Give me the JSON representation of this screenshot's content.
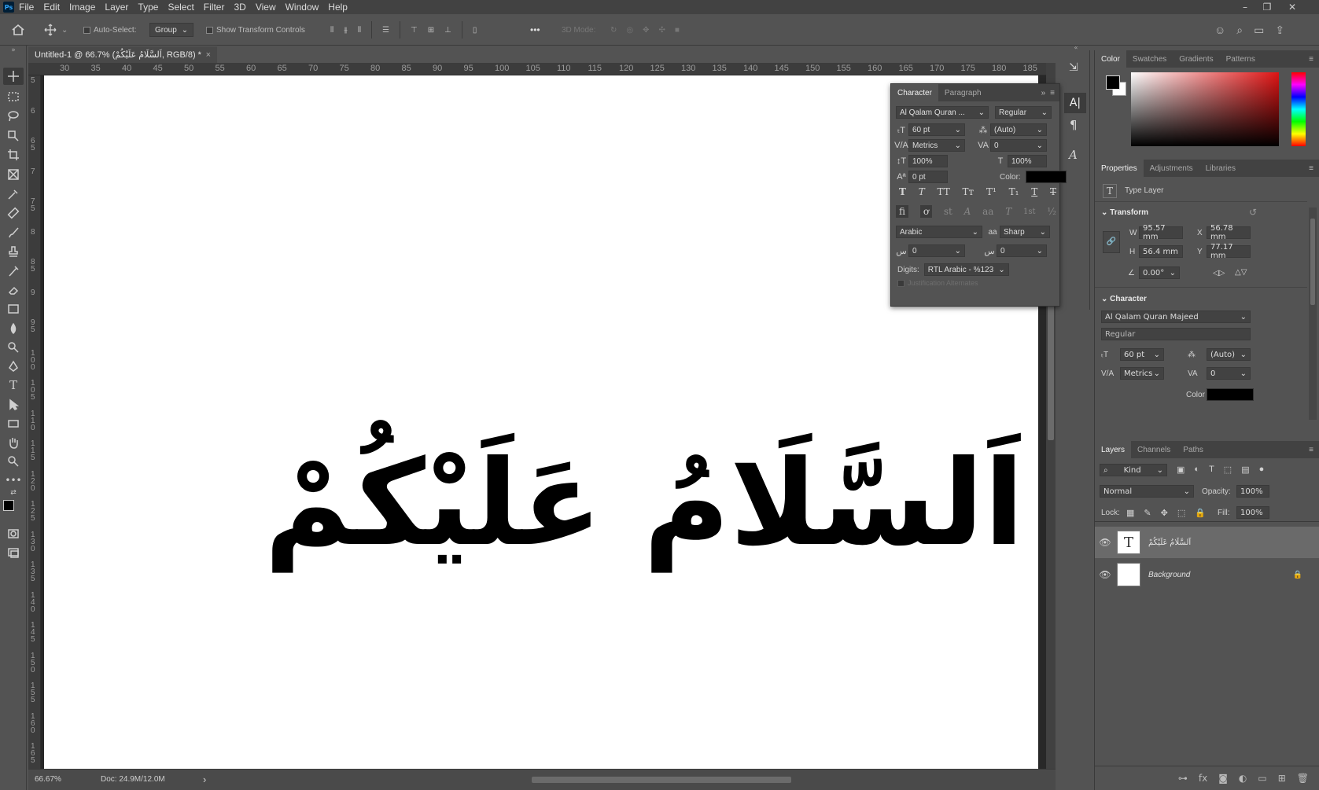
{
  "app": {
    "logo": "Ps",
    "document_tab": "Untitled-1 @ 66.7% (اَلسَّلَامُ عَلَيْكُمْ, RGB/8) *",
    "tab_close": "×"
  },
  "menu": [
    "File",
    "Edit",
    "Image",
    "Layer",
    "Type",
    "Select",
    "Filter",
    "3D",
    "View",
    "Window",
    "Help"
  ],
  "window_controls": {
    "minimize": "–",
    "restore": "❐",
    "close": "✕"
  },
  "options": {
    "auto_select_label": "Auto-Select:",
    "group_value": "Group",
    "transform_controls_label": "Show Transform Controls",
    "more": "•••",
    "mode_label": "3D Mode:"
  },
  "ruler_top": [
    "30",
    "35",
    "40",
    "45",
    "50",
    "55",
    "60",
    "65",
    "70",
    "75",
    "80",
    "85",
    "90",
    "95",
    "100",
    "105",
    "110",
    "115",
    "120",
    "125",
    "130",
    "135",
    "140",
    "145",
    "150",
    "155",
    "160",
    "165",
    "170",
    "175",
    "180",
    "185"
  ],
  "ruler_left": [
    "5",
    "6",
    "6 5",
    "7",
    "7 5",
    "8",
    "8 5",
    "9",
    "9 5",
    "1 0 0",
    "1 0 5",
    "1 1 0",
    "1 1 5",
    "1 2 0",
    "1 2 5",
    "1 3 0",
    "1 3 5",
    "1 4 0",
    "1 4 5",
    "1 5 0",
    "1 5 5",
    "1 6 0",
    "1 6 5"
  ],
  "canvas_text": "اَلسَّلَامُ عَلَيْكُمْ",
  "status": {
    "zoom": "66.67%",
    "doc": "Doc: 24.9M/12.0M",
    "arrow": "›"
  },
  "character_panel": {
    "tab_character": "Character",
    "tab_paragraph": "Paragraph",
    "font_family": "Al Qalam Quran ...",
    "font_style": "Regular",
    "size": "60 pt",
    "leading": "(Auto)",
    "kerning": "Metrics",
    "tracking": "0",
    "vscale": "100%",
    "hscale": "100%",
    "baseline": "0 pt",
    "color_label": "Color:",
    "color": "#000000",
    "language": "Arabic",
    "antialias_icon": "aa",
    "antialias": "Sharp",
    "ligature1": "0",
    "ligature2": "0",
    "digits_label": "Digits:",
    "digits_value": "RTL Arabic - %123",
    "justification": "Justification Alternates",
    "style_buttons": [
      "T",
      "T",
      "TT",
      "Tт",
      "T¹",
      "T₁",
      "T",
      "T"
    ],
    "opentype_buttons": [
      "fi",
      "ơ",
      "st",
      "A",
      "aa",
      "T",
      "1st",
      "½"
    ]
  },
  "color_panel": {
    "tabs": [
      "Color",
      "Swatches",
      "Gradients",
      "Patterns"
    ],
    "foreground": "#000000",
    "background": "#ffffff",
    "hue_color": "#e01414"
  },
  "properties_panel": {
    "tabs": [
      "Properties",
      "Adjustments",
      "Libraries"
    ],
    "layer_type": "Type Layer",
    "transform_label": "Transform",
    "w_label": "W",
    "w": "95.57 mm",
    "x_label": "X",
    "x": "56.78 mm",
    "h_label": "H",
    "h": "56.4 mm",
    "y_label": "Y",
    "y": "77.17 mm",
    "angle": "0.00°",
    "character_label": "Character",
    "font": "Al Qalam Quran Majeed",
    "style": "Regular",
    "size": "60 pt",
    "leading": "(Auto)",
    "kerning": "Metrics",
    "tracking": "0",
    "color_label": "Color"
  },
  "layers_panel": {
    "tabs": [
      "Layers",
      "Channels",
      "Paths"
    ],
    "kind": "Kind",
    "blend": "Normal",
    "opacity_label": "Opacity:",
    "opacity": "100%",
    "lock_label": "Lock:",
    "fill_label": "Fill:",
    "fill": "100%",
    "layers": [
      {
        "name": "اَلسَّلَامُ عَلَيْكُمْ",
        "type": "text"
      },
      {
        "name": "Background",
        "type": "image"
      }
    ]
  }
}
